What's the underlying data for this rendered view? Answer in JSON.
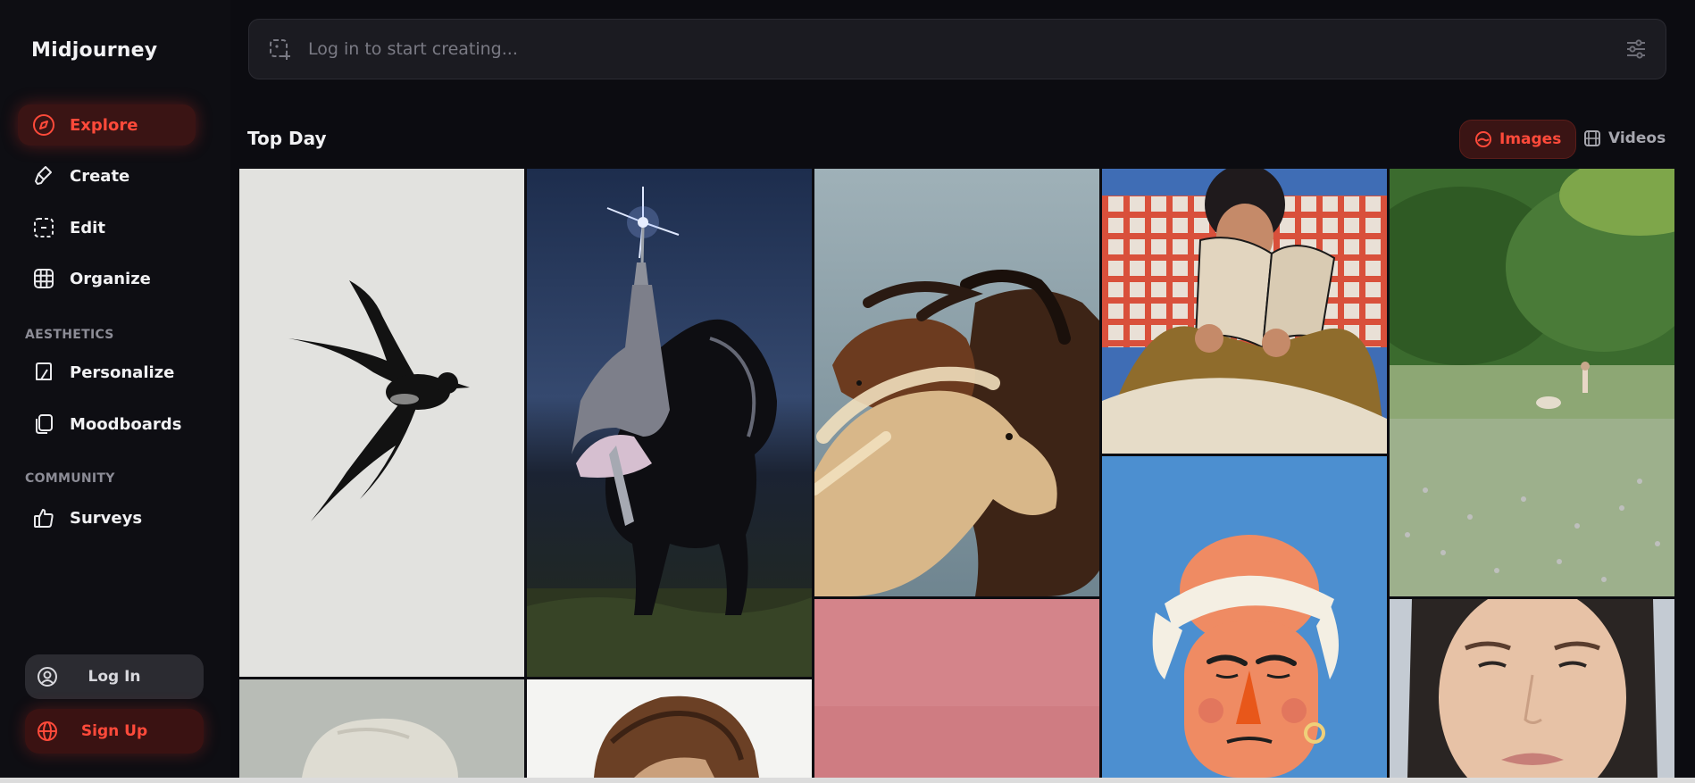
{
  "brand": {
    "name": "Midjourney"
  },
  "nav": {
    "items": [
      {
        "label": "Explore",
        "icon": "compass-icon",
        "active": true
      },
      {
        "label": "Create",
        "icon": "brush-icon"
      },
      {
        "label": "Edit",
        "icon": "edit-frame-icon"
      },
      {
        "label": "Organize",
        "icon": "grid-icon"
      }
    ],
    "aesthetics_heading": "AESTHETICS",
    "aesthetics_items": [
      {
        "label": "Personalize",
        "icon": "personalize-icon"
      },
      {
        "label": "Moodboards",
        "icon": "moodboard-icon"
      }
    ],
    "community_heading": "COMMUNITY",
    "community_items": [
      {
        "label": "Surveys",
        "icon": "thumbs-up-icon"
      }
    ]
  },
  "auth": {
    "login_label": "Log In",
    "signup_label": "Sign Up"
  },
  "prompt": {
    "placeholder": "Log in to start creating..."
  },
  "feed": {
    "title": "Top Day",
    "toggle": {
      "images_label": "Images",
      "videos_label": "Videos",
      "selected": "Images"
    },
    "tiles": [
      {
        "subject": "swallow-ink-drawing"
      },
      {
        "subject": "knight-on-horse-night"
      },
      {
        "subject": "two-galloping-horses"
      },
      {
        "subject": "woman-reading-illustration"
      },
      {
        "subject": "meadow-with-dog-and-girl"
      },
      {
        "subject": "pale-stone-object"
      },
      {
        "subject": "curly-hair-person"
      },
      {
        "subject": "pink-backdrop"
      },
      {
        "subject": "man-with-headband-illustration"
      },
      {
        "subject": "woman-portrait-closeup"
      }
    ]
  },
  "colors": {
    "background": "#0c0c11",
    "accent": "#ff4a3a",
    "active_bg": "#3a1414"
  }
}
